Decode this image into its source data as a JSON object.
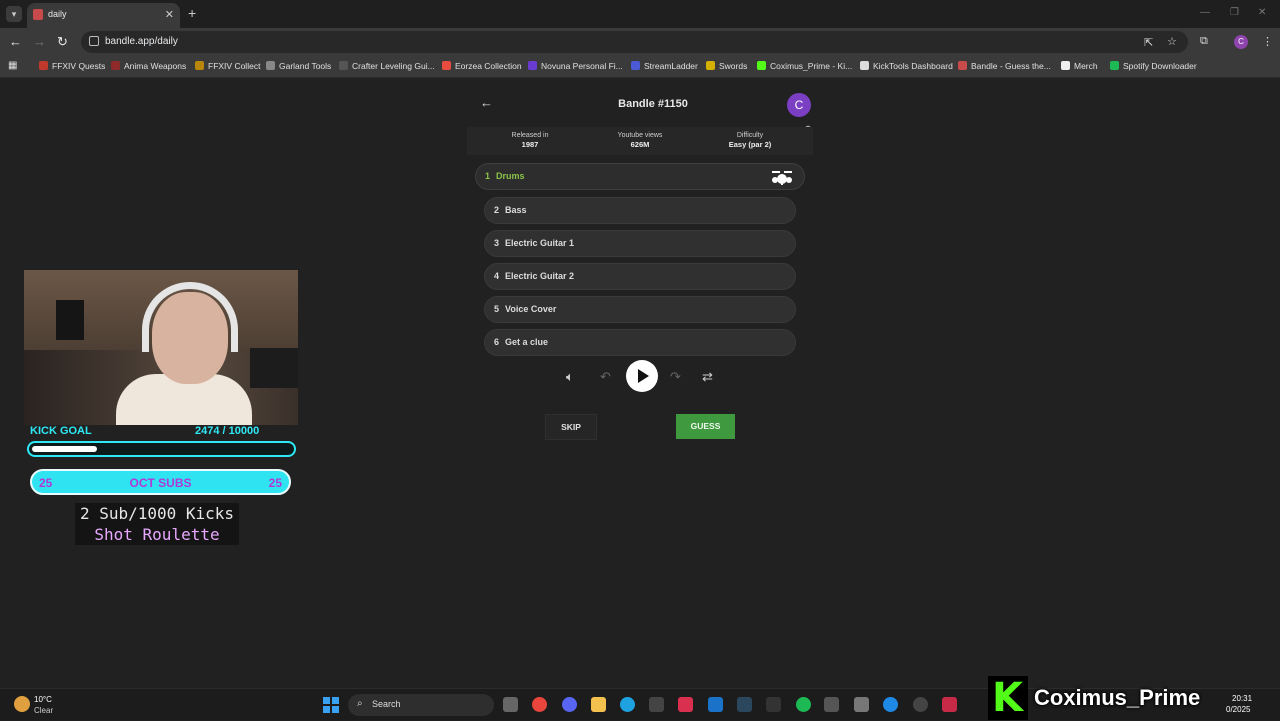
{
  "browser": {
    "tab_title": "daily",
    "url": "bandle.app/daily",
    "profile_initial": "C",
    "bookmarks": [
      {
        "label": "FFXIV Quests",
        "color": "#c0392b"
      },
      {
        "label": "Anima Weapons",
        "color": "#8e2a2a"
      },
      {
        "label": "FFXIV Collect",
        "color": "#b8860b"
      },
      {
        "label": "Garland Tools",
        "color": "#888888"
      },
      {
        "label": "Crafter Leveling Gui...",
        "color": "#555555"
      },
      {
        "label": "Eorzea Collection",
        "color": "#e74c3c"
      },
      {
        "label": "Novuna Personal Fi...",
        "color": "#6a3bd1"
      },
      {
        "label": "StreamLadder",
        "color": "#4b5bd6"
      },
      {
        "label": "Swords",
        "color": "#d4b000"
      },
      {
        "label": "Coximus_Prime - Ki...",
        "color": "#53fc18"
      },
      {
        "label": "KickTools Dashboard",
        "color": "#dddddd"
      },
      {
        "label": "Bandle - Guess the...",
        "color": "#c94a4a"
      },
      {
        "label": "Merch",
        "color": "#eeeeee"
      },
      {
        "label": "Spotify Downloader",
        "color": "#1db954"
      }
    ]
  },
  "game": {
    "title": "Bandle #1150",
    "avatar_initial": "C",
    "info": [
      {
        "label": "Released in",
        "value": "1987"
      },
      {
        "label": "Youtube views",
        "value": "626M"
      },
      {
        "label": "Difficulty",
        "value": "Easy (par 2)"
      }
    ],
    "stems": [
      {
        "num": "1",
        "label": "Drums",
        "active": true
      },
      {
        "num": "2",
        "label": "Bass",
        "active": false
      },
      {
        "num": "3",
        "label": "Electric Guitar 1",
        "active": false
      },
      {
        "num": "4",
        "label": "Electric Guitar 2",
        "active": false
      },
      {
        "num": "5",
        "label": "Voice Cover",
        "active": false
      },
      {
        "num": "6",
        "label": "Get a clue",
        "active": false
      }
    ],
    "skip_label": "SKIP",
    "guess_label": "GUESS"
  },
  "overlay": {
    "goal_label": "KICK GOAL",
    "goal_count": "2474  / 10000",
    "goal_progress": 0.2474,
    "subs_left": "25",
    "subs_mid": "OCT SUBS",
    "subs_right": "25",
    "roulette_line1": "2 Sub/1000 Kicks",
    "roulette_line2": "Shot Roulette",
    "streamer_name": "Coximus_Prime"
  },
  "taskbar": {
    "weather_temp": "10°C",
    "weather_desc": "Clear",
    "search_label": "Search",
    "time": "20:31",
    "date": "0/2025"
  },
  "colors": {
    "accent_green": "#8bc34a",
    "guess_green": "#3f9a3f",
    "kick_green": "#53fc18",
    "overlay_cyan": "#2ee8f5",
    "overlay_purple": "#b03ad8"
  }
}
